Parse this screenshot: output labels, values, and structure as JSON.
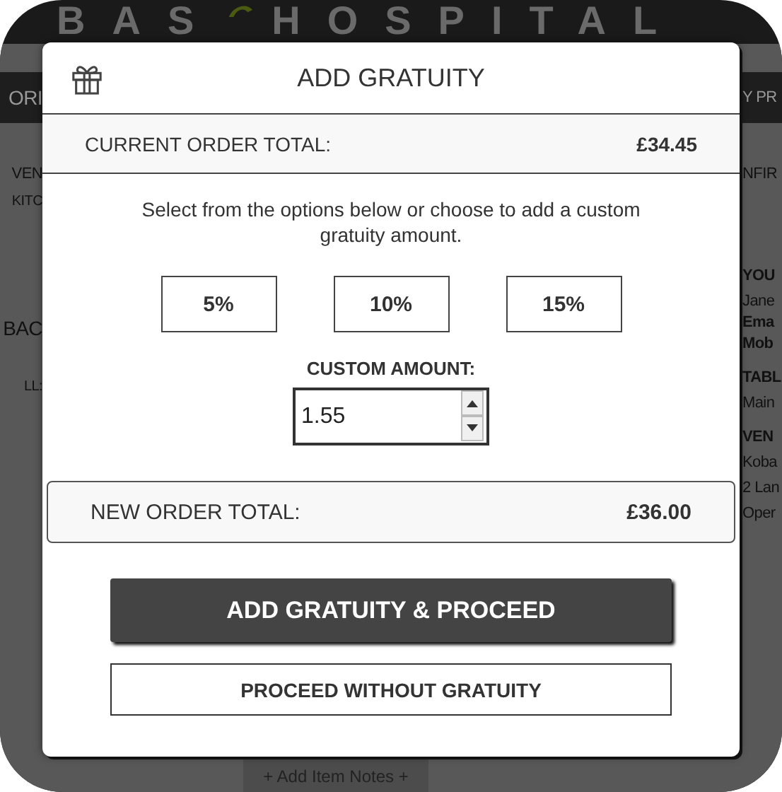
{
  "background": {
    "logo_words": [
      "BAS",
      "HOSPITAL"
    ],
    "left": [
      {
        "text": "ORI",
        "kind": "band"
      },
      {
        "text": "VEN",
        "kind": "heading"
      },
      {
        "text": "KITC",
        "kind": "small"
      },
      {
        "text": "BAC",
        "kind": "title"
      },
      {
        "text": "LL:",
        "kind": "small"
      }
    ],
    "right": [
      {
        "text": "Y PR",
        "kind": "band"
      },
      {
        "text": "NFIR",
        "kind": "heading"
      },
      {
        "text": "YOU",
        "kind": "title"
      },
      {
        "text": "Jane",
        "kind": "line"
      },
      {
        "text": "Ema",
        "kind": "bold"
      },
      {
        "text": "Mob",
        "kind": "bold"
      },
      {
        "text": "TABL",
        "kind": "title"
      },
      {
        "text": "Main",
        "kind": "line"
      },
      {
        "text": "VEN",
        "kind": "title"
      },
      {
        "text": "Koba",
        "kind": "line"
      },
      {
        "text": "2 Lan",
        "kind": "line"
      },
      {
        "text": "Oper",
        "kind": "line"
      }
    ],
    "bottom_button": "+ Add Item Notes +"
  },
  "modal": {
    "title": "ADD GRATUITY",
    "current_total": {
      "label": "CURRENT ORDER TOTAL:",
      "value": "£34.45"
    },
    "instructions": "Select from the options below or choose to add a custom gratuity amount.",
    "options": [
      {
        "label": "5%",
        "selected": false
      },
      {
        "label": "10%",
        "selected": false
      },
      {
        "label": "15%",
        "selected": false
      }
    ],
    "custom_amount": {
      "label": "CUSTOM AMOUNT:",
      "value": "1.55"
    },
    "new_total": {
      "label": "NEW ORDER TOTAL:",
      "value": "£36.00"
    },
    "buttons": [
      {
        "label": "ADD GRATUITY & PROCEED",
        "kind": "primary"
      },
      {
        "label": "PROCEED WITHOUT GRATUITY",
        "kind": "secondary"
      }
    ]
  }
}
